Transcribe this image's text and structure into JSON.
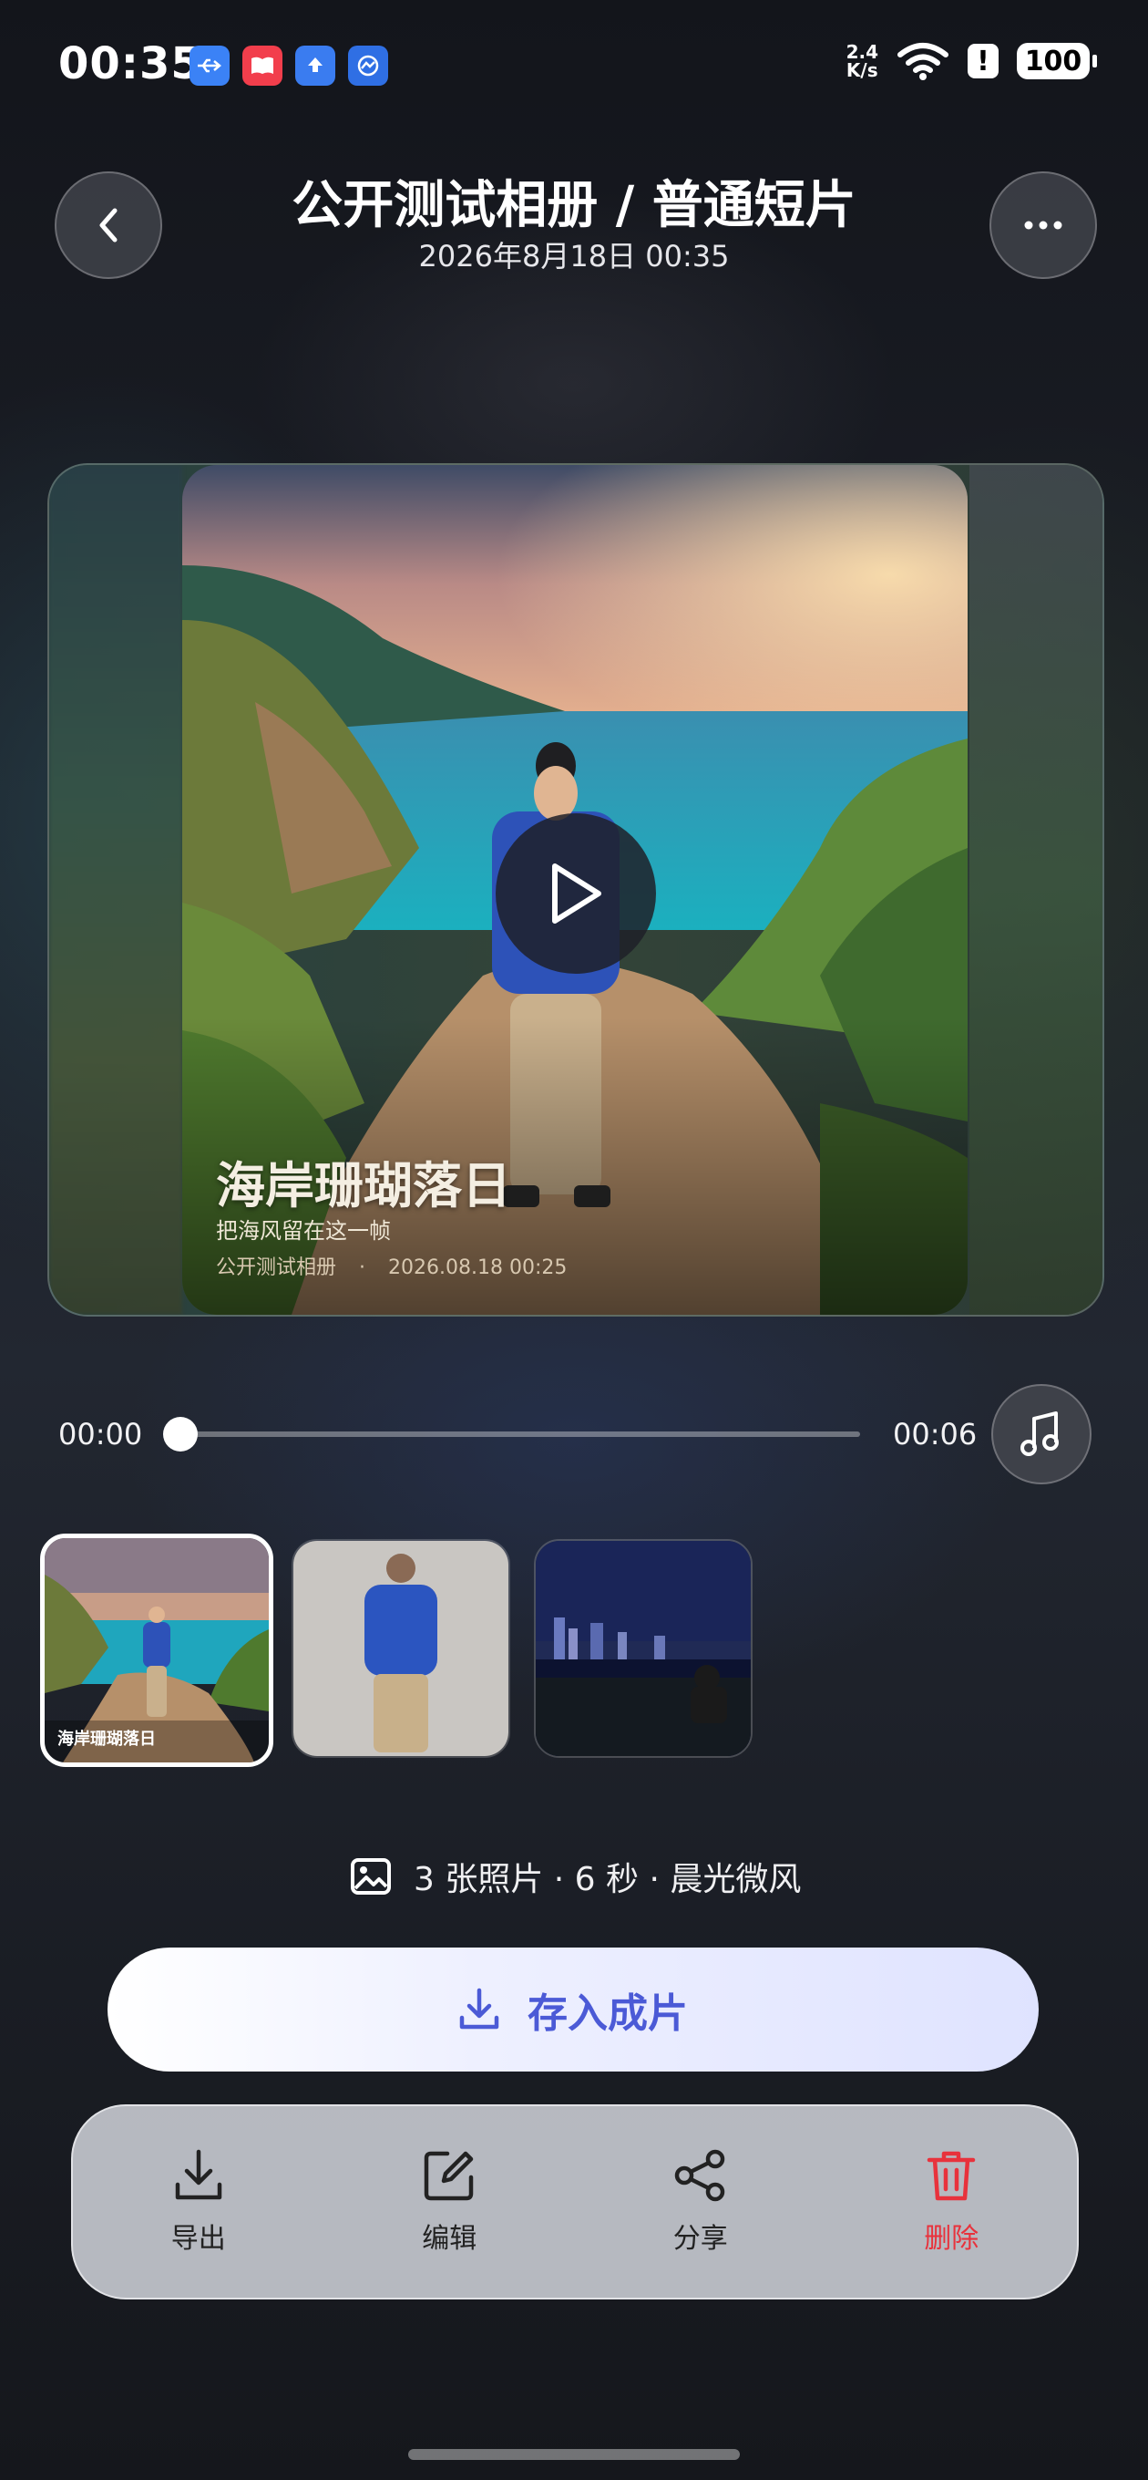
{
  "status_bar": {
    "time": "00:35",
    "net_speed_value": "2.4",
    "net_speed_unit": "K/s",
    "battery": "100",
    "notification_icons": [
      "usb-icon",
      "book-icon",
      "upload-icon",
      "gallery-icon"
    ]
  },
  "header": {
    "title": "公开测试相册 / 普通短片",
    "subtitle": "2026年8月18日  00:35"
  },
  "player": {
    "overlay_title": "海岸珊瑚落日",
    "overlay_subtitle": "把海风留在这一帧",
    "overlay_album": "公开测试相册",
    "overlay_date": "2026.08.18 00:25",
    "overlay_separator": "·"
  },
  "progress": {
    "current": "00:00",
    "total": "00:06",
    "position": 0
  },
  "thumbnails": [
    {
      "caption": "海岸珊瑚落日",
      "selected": true
    },
    {
      "caption": "",
      "selected": false
    },
    {
      "caption": "",
      "selected": false
    }
  ],
  "info": {
    "text": "3 张照片 · 6 秒 · 晨光微风"
  },
  "primary_action": {
    "label": "存入成片"
  },
  "actions": [
    {
      "label": "导出",
      "icon": "download-icon"
    },
    {
      "label": "编辑",
      "icon": "edit-icon"
    },
    {
      "label": "分享",
      "icon": "share-icon"
    },
    {
      "label": "删除",
      "icon": "trash-icon"
    }
  ],
  "colors": {
    "accent": "#4b5ad6",
    "danger": "#e8323c",
    "background": "#14161c"
  }
}
